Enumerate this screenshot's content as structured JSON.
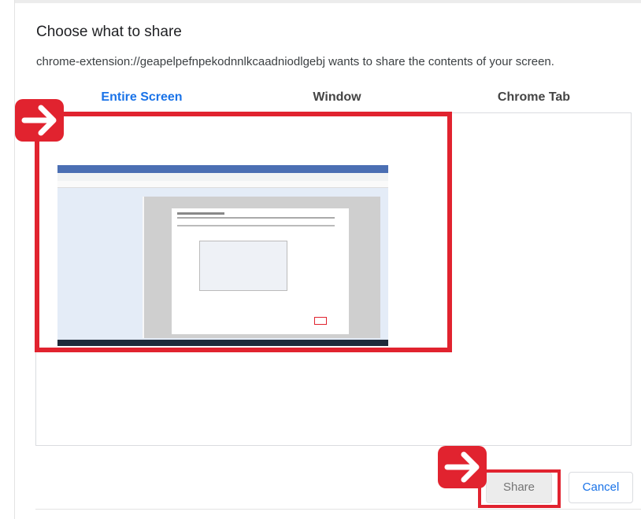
{
  "dialog": {
    "title": "Choose what to share",
    "description": "chrome-extension://geapelpefnpekodnnlkcaadniodlgebj wants to share the contents of your screen."
  },
  "tabs": [
    {
      "label": "Entire Screen",
      "selected": true
    },
    {
      "label": "Window",
      "selected": false
    },
    {
      "label": "Chrome Tab",
      "selected": false
    }
  ],
  "buttons": {
    "share_label": "Share",
    "cancel_label": "Cancel"
  },
  "colors": {
    "accent": "#1a73e8",
    "annotation": "#e1232f",
    "disabled_button_bg": "#ececec"
  },
  "icons": {
    "annotation": "right-arrow-icon"
  }
}
